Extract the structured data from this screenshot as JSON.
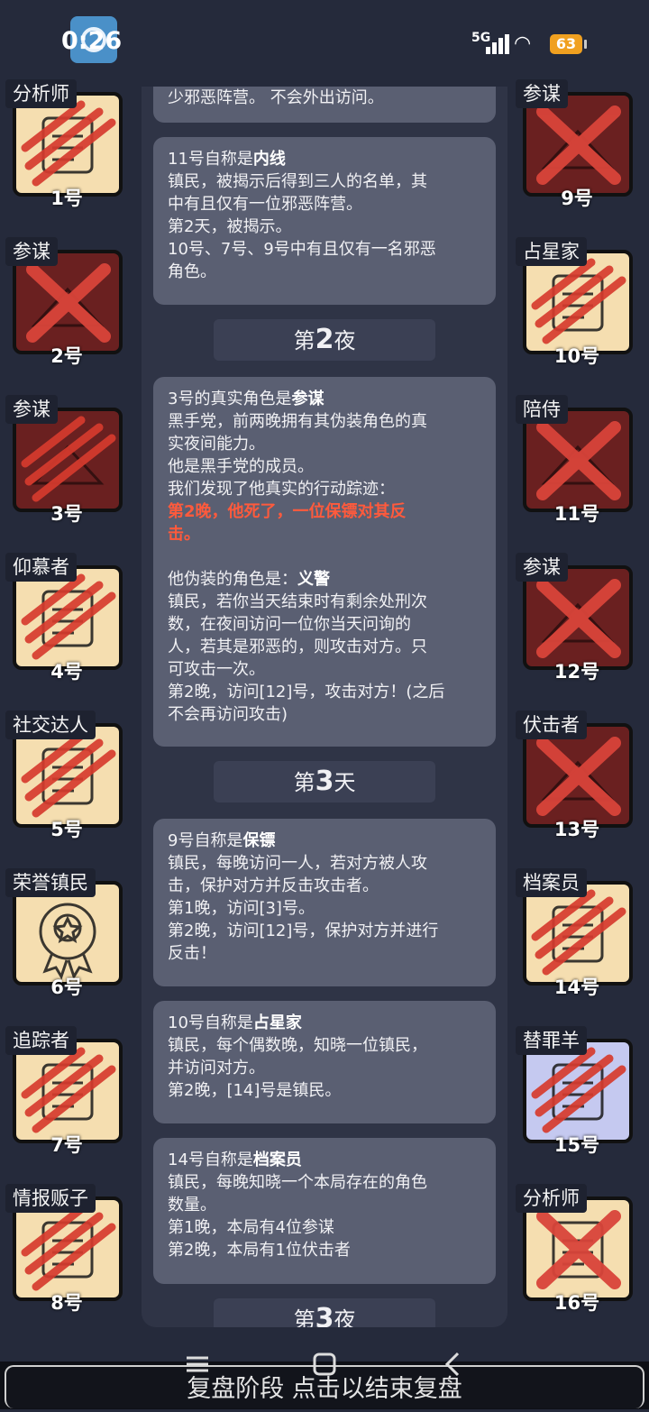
{
  "status_bar": {
    "time": "0:26",
    "network": "5G",
    "battery": "63"
  },
  "players_left": [
    {
      "role": "分析师",
      "num": "1号",
      "state": "dead",
      "icon": "analyst-icon"
    },
    {
      "role": "参谋",
      "num": "2号",
      "state": "evil-x",
      "icon": "strategist-icon"
    },
    {
      "role": "参谋",
      "num": "3号",
      "state": "evil-dead",
      "icon": "strategist-icon"
    },
    {
      "role": "仰慕者",
      "num": "4号",
      "state": "dead",
      "icon": "admirer-icon"
    },
    {
      "role": "社交达人",
      "num": "5号",
      "state": "dead",
      "icon": "socialite-icon"
    },
    {
      "role": "荣誉镇民",
      "num": "6号",
      "state": "alive",
      "icon": "medal-icon"
    },
    {
      "role": "追踪者",
      "num": "7号",
      "state": "dead",
      "icon": "tracker-icon"
    },
    {
      "role": "情报贩子",
      "num": "8号",
      "state": "dead",
      "icon": "informant-icon"
    }
  ],
  "players_right": [
    {
      "role": "参谋",
      "num": "9号",
      "state": "evil-x",
      "icon": "strategist-icon"
    },
    {
      "role": "占星家",
      "num": "10号",
      "state": "dead",
      "icon": "astrologer-icon"
    },
    {
      "role": "陪侍",
      "num": "11号",
      "state": "evil-x",
      "icon": "escort-icon"
    },
    {
      "role": "参谋",
      "num": "12号",
      "state": "evil-x",
      "icon": "strategist-icon"
    },
    {
      "role": "伏击者",
      "num": "13号",
      "state": "evil-x",
      "icon": "ambusher-icon"
    },
    {
      "role": "档案员",
      "num": "14号",
      "state": "dead",
      "icon": "archivist-icon"
    },
    {
      "role": "替罪羊",
      "num": "15号",
      "state": "scapegoat-dead",
      "icon": "scapegoat-icon"
    },
    {
      "role": "分析师",
      "num": "16号",
      "state": "alive-x",
      "icon": "analyst-icon"
    }
  ],
  "log": {
    "card0": {
      "l1": "少邪恶阵营。 不会外出访问。"
    },
    "card1": {
      "head_pre": "11号自称是",
      "head_role": "内线",
      "l1": "镇民，被揭示后得到三人的名单，其",
      "l2": "中有且仅有一位邪恶阵营。",
      "l3": "第2天，被揭示。",
      "l4": "10号、7号、9号中有且仅有一名邪恶",
      "l5": "角色。"
    },
    "phase1": {
      "pre": "第",
      "num": "2",
      "post": "夜"
    },
    "card2": {
      "head_pre": "3号的真实角色是",
      "head_role": "参谋",
      "l1": "黑手党，前两晚拥有其伪装角色的真",
      "l2": "实夜间能力。",
      "l3": "他是黑手党的成员。",
      "l4": "我们发现了他真实的行动踪迹：",
      "red1": "第2晚，他死了，一位保镖对其反",
      "red2": "击。",
      "disguise_pre": "他伪装的角色是：",
      "disguise_role": "义警",
      "l5": "镇民，若你当天结束时有剩余处刑次",
      "l6": "数，在夜间访问一位你当天问询的",
      "l7": "人，若其是邪恶的，则攻击对方。只",
      "l8": "可攻击一次。",
      "l9": "第2晚，访问[12]号，攻击对方！(之后",
      "l10": "不会再访问攻击)"
    },
    "phase2": {
      "pre": "第",
      "num": "3",
      "post": "天"
    },
    "card3": {
      "head_pre": "9号自称是",
      "head_role": "保镖",
      "l1": "镇民，每晚访问一人，若对方被人攻",
      "l2": "击，保护对方并反击攻击者。",
      "l3": "第1晚，访问[3]号。",
      "l4": "第2晚，访问[12]号，保护对方并进行",
      "l5": "反击！"
    },
    "card4": {
      "head_pre": "10号自称是",
      "head_role": "占星家",
      "l1": "镇民，每个偶数晚，知晓一位镇民，",
      "l2": "并访问对方。",
      "l3": "第2晚，[14]号是镇民。"
    },
    "card5": {
      "head_pre": "14号自称是",
      "head_role": "档案员",
      "l1": "镇民，每晚知晓一个本局存在的角色",
      "l2": "数量。",
      "l3": "第1晚，本局有4位参谋",
      "l4": "第2晚，本局有1位伏击者"
    },
    "phase3": {
      "pre": "第",
      "num": "3",
      "post": "夜"
    }
  },
  "bottom_button": "复盘阶段 点击以结束复盘"
}
